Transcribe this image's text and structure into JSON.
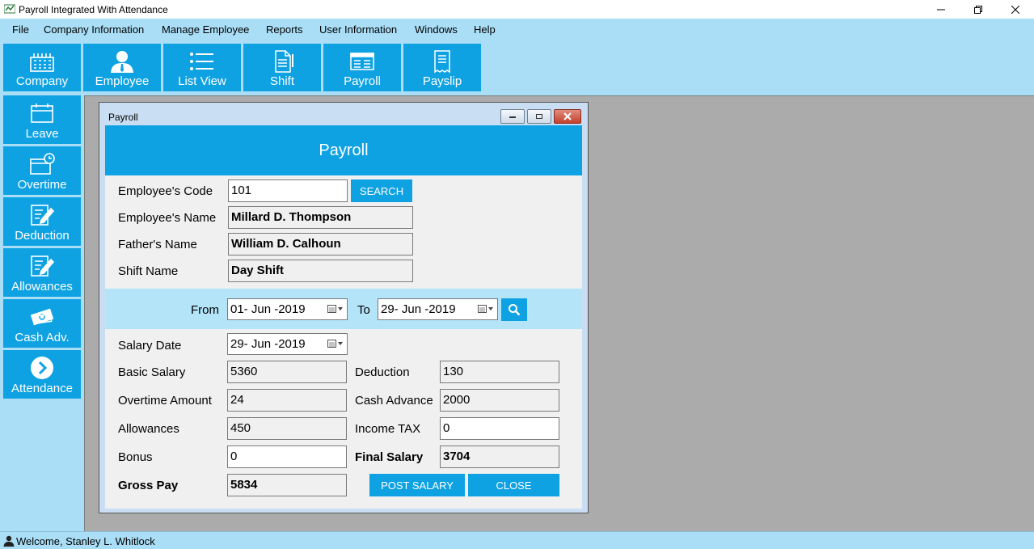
{
  "window": {
    "title": "Payroll Integrated With Attendance"
  },
  "menu": [
    "File",
    "Company Information",
    "Manage Employee",
    "Reports",
    "User Information",
    "Windows",
    "Help"
  ],
  "toolbar": [
    {
      "label": "Company",
      "icon": "building-icon"
    },
    {
      "label": "Employee",
      "icon": "employee-icon"
    },
    {
      "label": "List View",
      "icon": "list-icon"
    },
    {
      "label": "Shift",
      "icon": "shift-document-icon"
    },
    {
      "label": "Payroll",
      "icon": "payroll-card-icon"
    },
    {
      "label": "Payslip",
      "icon": "payslip-icon"
    }
  ],
  "sidebar": [
    {
      "label": "Leave",
      "icon": "calendar-icon"
    },
    {
      "label": "Overtime",
      "icon": "clock-calendar-icon"
    },
    {
      "label": "Deduction",
      "icon": "edit-document-icon"
    },
    {
      "label": "Allowances",
      "icon": "edit-document-icon"
    },
    {
      "label": "Cash Adv.",
      "icon": "cash-icon"
    },
    {
      "label": "Attendance",
      "icon": "chevron-circle-icon"
    }
  ],
  "payroll": {
    "window_title": "Payroll",
    "header": "Payroll",
    "employee_code_label": "Employee's Code",
    "employee_code": "101",
    "search_label": "SEARCH",
    "employee_name_label": "Employee's Name",
    "employee_name": "Millard D. Thompson",
    "father_name_label": "Father's Name",
    "father_name": "William D. Calhoun",
    "shift_name_label": "Shift Name",
    "shift_name": "Day Shift",
    "from_label": "From",
    "from_date": "01- Jun -2019",
    "to_label": "To",
    "to_date": "29- Jun -2019",
    "salary_date_label": "Salary Date",
    "salary_date": "29- Jun -2019",
    "basic_salary_label": "Basic Salary",
    "basic_salary": "5360",
    "overtime_amount_label": "Overtime Amount",
    "overtime_amount": "24",
    "allowances_label": "Allowances",
    "allowances": "450",
    "bonus_label": "Bonus",
    "bonus": "0",
    "gross_pay_label": "Gross Pay",
    "gross_pay": "5834",
    "deduction_label": "Deduction",
    "deduction": "130",
    "cash_advance_label": "Cash Advance",
    "cash_advance": "2000",
    "income_tax_label": "Income TAX",
    "income_tax": "0",
    "final_salary_label": "Final Salary",
    "final_salary": "3704",
    "post_salary_label": "POST SALARY",
    "close_label": "CLOSE"
  },
  "status": {
    "welcome": "Welcome, Stanley L. Whitlock"
  },
  "colors": {
    "accent": "#0fa2e3",
    "app_background": "#a9def6",
    "mdi_background": "#ababab"
  }
}
